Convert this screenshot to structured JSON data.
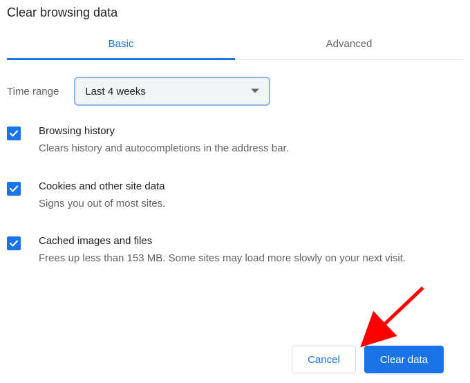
{
  "title": "Clear browsing data",
  "tabs": {
    "basic": "Basic",
    "advanced": "Advanced"
  },
  "timerange": {
    "label": "Time range",
    "value": "Last 4 weeks"
  },
  "options": [
    {
      "title": "Browsing history",
      "desc": "Clears history and autocompletions in the address bar.",
      "checked": true
    },
    {
      "title": "Cookies and other site data",
      "desc": "Signs you out of most sites.",
      "checked": true
    },
    {
      "title": "Cached images and files",
      "desc": "Frees up less than 153 MB. Some sites may load more slowly on your next visit.",
      "checked": true
    }
  ],
  "buttons": {
    "cancel": "Cancel",
    "clear": "Clear data"
  },
  "colors": {
    "accent": "#1a73e8",
    "muted": "#5f6368"
  }
}
